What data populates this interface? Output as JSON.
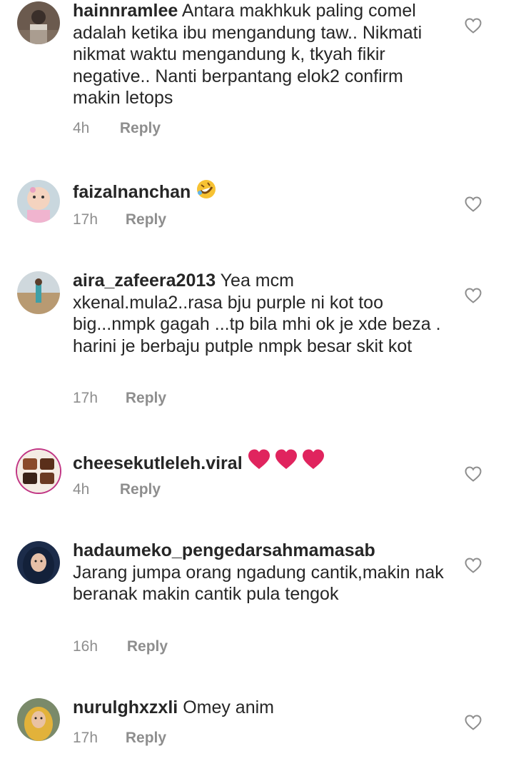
{
  "comments": [
    {
      "username": "hainnramlee",
      "text": "Antara makhkuk paling comel adalah ketika ibu mengandung taw.. Nikmati nikmat waktu mengandung k, tkyah fikir negative.. Nanti berpantang elok2 confirm makin letops",
      "time": "4h",
      "reply": "Reply"
    },
    {
      "username": "faizalnanchan",
      "text": "",
      "emoji": "rolling-on-floor-laughing-emoji",
      "time": "17h",
      "reply": "Reply"
    },
    {
      "username": "aira_zafeera2013",
      "text": "Yea mcm xkenal.mula2..rasa bju purple ni kot too big...nmpk gagah ...tp bila mhi ok je xde beza . harini je berbaju putple nmpk besar skit kot",
      "time": "17h",
      "reply": "Reply"
    },
    {
      "username": "cheesekutleleh.viral",
      "text": "",
      "emoji": "three-red-hearts-emoji",
      "time": "4h",
      "reply": "Reply"
    },
    {
      "username": "hadaumeko_pengedarsahmamasab",
      "text": "Jarang jumpa orang ngadung cantik,makin nak beranak makin cantik pula tengok",
      "time": "16h",
      "reply": "Reply"
    },
    {
      "username": "nurulghxzxli",
      "text": "Omey anim",
      "time": "17h",
      "reply": "Reply"
    }
  ],
  "colors": {
    "text": "#262626",
    "muted": "#8e8e8e",
    "heart_stroke": "#8e8e8e",
    "emoji_heart": "#e0245e"
  }
}
